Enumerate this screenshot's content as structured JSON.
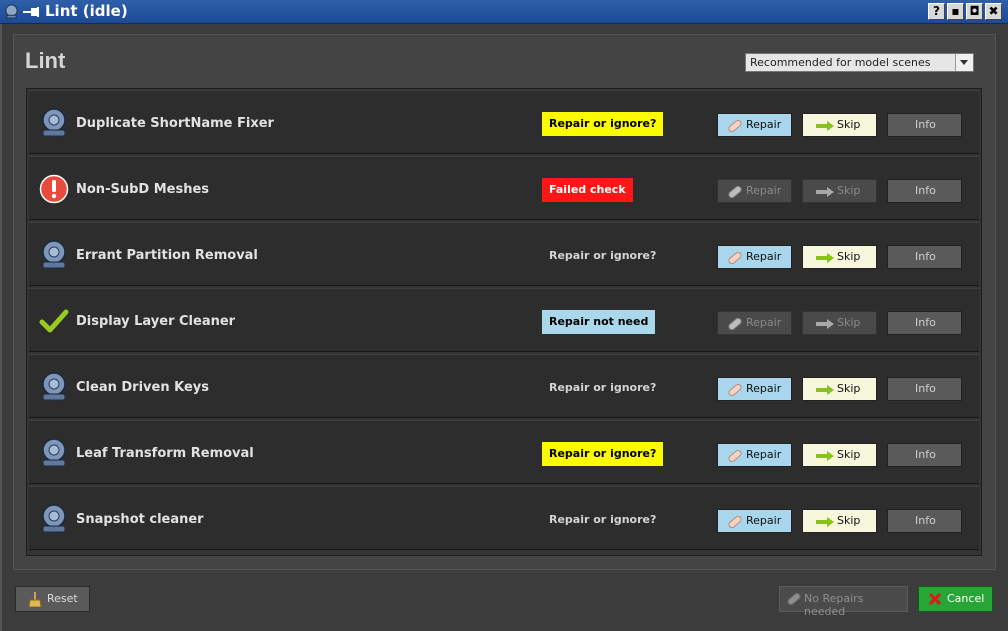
{
  "window": {
    "title": "Lint (idle)",
    "controls": [
      "?",
      "▪",
      "◘",
      "✖"
    ]
  },
  "header": {
    "title": "Lint",
    "preset_selected": "Recommended for model scenes"
  },
  "rows": [
    {
      "icon": "bell-icon",
      "name": "Duplicate ShortName Fixer",
      "status": "Repair or ignore?",
      "status_style": "yellow",
      "repair_label": "Repair",
      "skip_label": "Skip",
      "info_label": "Info",
      "enabled": true
    },
    {
      "icon": "error-icon",
      "name": "Non-SubD Meshes",
      "status": "Failed check",
      "status_style": "red",
      "repair_label": "Repair",
      "skip_label": "Skip",
      "info_label": "Info",
      "enabled": false
    },
    {
      "icon": "bell-icon",
      "name": "Errant Partition Removal",
      "status": "Repair or ignore?",
      "status_style": "plain",
      "repair_label": "Repair",
      "skip_label": "Skip",
      "info_label": "Info",
      "enabled": true
    },
    {
      "icon": "checkmark-icon",
      "name": "Display Layer Cleaner",
      "status": "Repair not need",
      "status_style": "blue",
      "repair_label": "Repair",
      "skip_label": "Skip",
      "info_label": "Info",
      "enabled": false
    },
    {
      "icon": "bell-icon",
      "name": "Clean Driven Keys",
      "status": "Repair or ignore?",
      "status_style": "plain",
      "repair_label": "Repair",
      "skip_label": "Skip",
      "info_label": "Info",
      "enabled": true
    },
    {
      "icon": "bell-icon",
      "name": "Leaf Transform Removal",
      "status": "Repair or ignore?",
      "status_style": "yellow",
      "repair_label": "Repair",
      "skip_label": "Skip",
      "info_label": "Info",
      "enabled": true
    },
    {
      "icon": "bell-icon",
      "name": "Snapshot cleaner",
      "status": "Repair or ignore?",
      "status_style": "plain",
      "repair_label": "Repair",
      "skip_label": "Skip",
      "info_label": "Info",
      "enabled": true
    }
  ],
  "footer": {
    "reset_label": "Reset",
    "no_repairs_label": "No Repairs needed",
    "cancel_label": "Cancel"
  },
  "colors": {
    "status_yellow": "#fbfb00",
    "status_red": "#ff1515",
    "status_blue": "#a9d8ea",
    "repair_button": "#a8d6ec",
    "skip_button": "#f6f7dd",
    "cancel_button": "#27a536",
    "title_bar": "#1c4a97"
  }
}
